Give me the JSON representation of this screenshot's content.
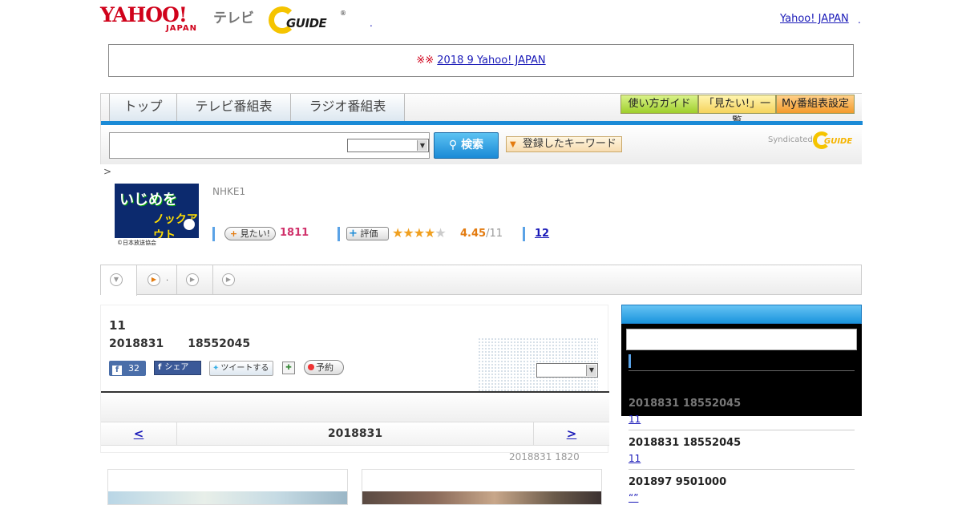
{
  "header": {
    "yahoo_logo": "YAHOO!",
    "yahoo_sub": "JAPAN",
    "tv_label": "テレビ",
    "gguide_logo": "GUIDE",
    "dot": ".",
    "yahoo_japan_link": "Yahoo! JAPAN",
    "dot2": "."
  },
  "notice": {
    "marks": "※※",
    "link": "2018 9 Yahoo! JAPAN"
  },
  "nav": {
    "tabs": [
      "トップ",
      "テレビ番組表",
      "ラジオ番組表"
    ],
    "guide_button": "使い方ガイド",
    "mitai_list_button": "「見たい!」一覧",
    "my_guide_button": "My番組表設定"
  },
  "search": {
    "input_value": "",
    "select_value": "",
    "search_button": "検索",
    "keyword_button": "登録したキーワード",
    "syndicated": "Syndicated"
  },
  "breadcrumb": ">",
  "program": {
    "thumb_title_1": "いじめを",
    "thumb_title_2": "ノックアウト",
    "thumb_caption": "©日本放送協会",
    "channel": "NHKE1",
    "mitai_label": "見たい!",
    "mitai_count": "1811",
    "hyoka_label": "評価",
    "rating": 4.45,
    "score": "4.45",
    "score_of": "/11",
    "review_count": "12"
  },
  "subtabs": {
    "tab2_label": "."
  },
  "episode": {
    "title": "11",
    "date": "2018831",
    "time": "18552045",
    "fb_count": "32",
    "fb_share": "シェア",
    "tweet": "ツイートする",
    "reserve": "予約",
    "select_value": ""
  },
  "pager": {
    "prev": "<",
    "date": "2018831",
    "next": ">"
  },
  "below_date": "2018831  1820",
  "sidebar": {
    "items": [
      {
        "datetime": "2018831  18552045",
        "link": "11"
      },
      {
        "datetime": "2018831  18552045",
        "link": "11"
      },
      {
        "datetime": "201897  9501000",
        "link": "“”"
      }
    ]
  }
}
